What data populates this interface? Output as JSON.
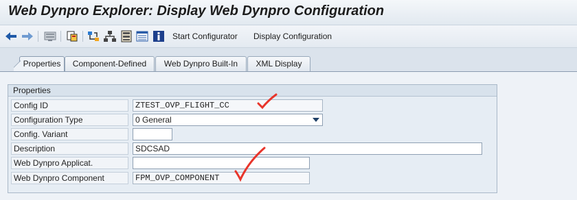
{
  "window": {
    "title": "Web Dynpro Explorer: Display Web Dynpro Configuration"
  },
  "toolbar": {
    "icons": [
      "back-arrow-icon",
      "forward-arrow-icon",
      "display-change-icon",
      "other-object-icon",
      "hierarchy-icon",
      "tree-structure-icon",
      "layout-icon",
      "list-icon",
      "info-icon"
    ],
    "start_configurator": "Start Configurator",
    "display_configuration": "Display Configuration"
  },
  "tabs": [
    {
      "label": "Properties",
      "active": true
    },
    {
      "label": "Component-Defined",
      "active": false
    },
    {
      "label": "Web Dynpro Built-In",
      "active": false
    },
    {
      "label": "XML Display",
      "active": false
    }
  ],
  "properties": {
    "group_title": "Properties",
    "fields": [
      {
        "label": "Config ID",
        "value": "ZTEST_OVP_FLIGHT_CC"
      },
      {
        "label": "Configuration Type",
        "value": "0 General"
      },
      {
        "label": "Config. Variant",
        "value": ""
      },
      {
        "label": "Description",
        "value": "SDCSAD"
      },
      {
        "label": "Web Dynpro Applicat.",
        "value": ""
      },
      {
        "label": "Web Dynpro Component",
        "value": "FPM_OVP_COMPONENT"
      }
    ]
  },
  "colors": {
    "checkmark": "#e8352b",
    "title_bar": "#e2e9f0",
    "panel": "#eef2f7",
    "dropdown_arrow": "#1e3f66"
  }
}
